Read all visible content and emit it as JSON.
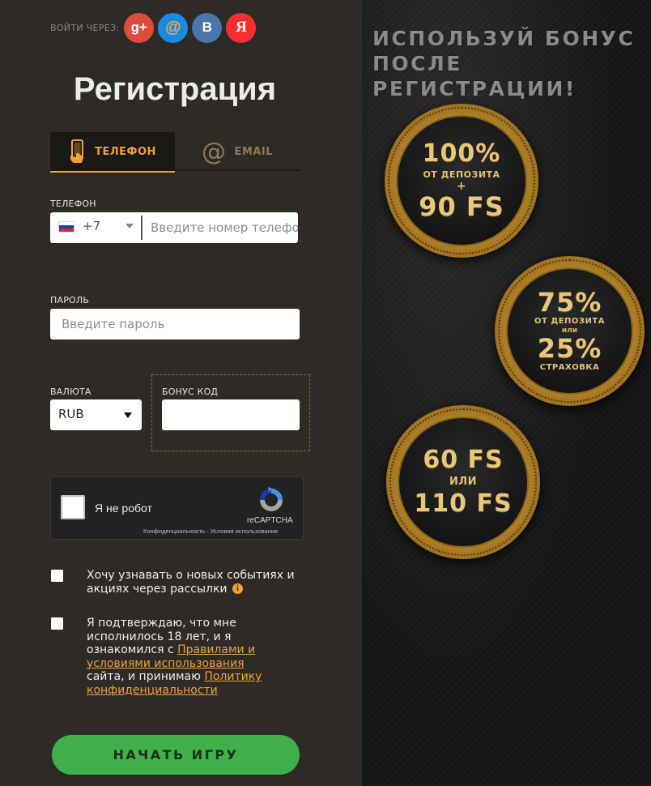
{
  "social": {
    "label": "ВОЙТИ ЧЕРЕЗ:",
    "google": "g+",
    "mailru": "@",
    "vk": "B",
    "yandex": "Я"
  },
  "title": "Регистрация",
  "tabs": {
    "phone": "ТЕЛЕФОН",
    "email": "EMAIL",
    "email_symbol": "@"
  },
  "form": {
    "phone_label": "ТЕЛЕФОН",
    "phone_code": "+7",
    "phone_placeholder": "Введите номер телефона",
    "password_label": "ПАРОЛЬ",
    "password_placeholder": "Введите пароль",
    "currency_label": "ВАЛЮТА",
    "currency_value": "RUB",
    "bonus_label": "БОНУС КОД",
    "bonus_value": ""
  },
  "captcha": {
    "text": "Я не робот",
    "brand": "reCAPTCHA",
    "links": "Конфиденциальность - Условия использования"
  },
  "checkboxes": {
    "newsletter_text": "Хочу узнавать о новых событиях и акциях через рассылки",
    "info_symbol": "i",
    "age_prefix": "Я подтверждаю, что мне исполнилось 18 лет, и я ознакомился с ",
    "rules_link": "Правилами и условиями использования",
    "age_middle": " сайта, и принимаю ",
    "privacy_link": "Политику конфиденциальности"
  },
  "start_button": "НАЧАТЬ ИГРУ",
  "promo": {
    "title": "ИСПОЛЬЗУЙ БОНУС ПОСЛЕ РЕГИСТРАЦИИ!",
    "medal1": {
      "big1": "100%",
      "small1": "ОТ ДЕПОЗИТА",
      "plus": "+",
      "big2": "90 FS"
    },
    "medal2": {
      "big1": "75%",
      "small1": "ОТ ДЕПОЗИТА",
      "or": "или",
      "big2": "25%",
      "small2": "СТРАХОВКА"
    },
    "medal3": {
      "big1": "60 FS",
      "or": "ИЛИ",
      "big2": "110 FS"
    }
  },
  "colors": {
    "accent": "#f0a13a",
    "button": "#40b04a",
    "panel": "#2e2b26"
  }
}
